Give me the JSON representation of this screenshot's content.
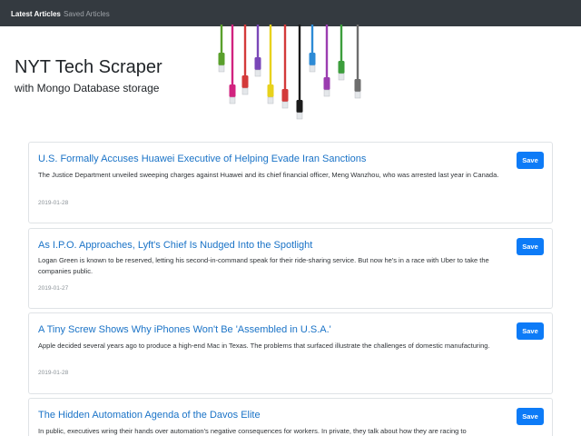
{
  "nav": {
    "items": [
      {
        "label": "Latest Articles",
        "active": true
      },
      {
        "label": "Saved Articles",
        "active": false
      }
    ]
  },
  "hero": {
    "title": "NYT Tech Scraper",
    "subtitle": "with Mongo Database storage",
    "cable_colors": [
      "#5aa02c",
      "#d1237f",
      "#d33a3a",
      "#7a47b8",
      "#e8d21c",
      "#d33a3a",
      "#1b1b1b",
      "#2d8bd6",
      "#9b3db0",
      "#3c9e3c",
      "#6e6e6e"
    ]
  },
  "articles": [
    {
      "title": "U.S. Formally Accuses Huawei Executive of Helping Evade Iran Sanctions",
      "summary": "The Justice Department unveiled sweeping charges against Huawei and its chief financial officer, Meng Wanzhou, who was arrested last year in Canada.",
      "date": "2019-01-28",
      "save_label": "Save"
    },
    {
      "title": "As I.P.O. Approaches, Lyft's Chief Is Nudged Into the Spotlight",
      "summary": "Logan Green is known to be reserved, letting his second-in-command speak for their ride-sharing service. But now he's in a race with Uber to take the companies public.",
      "date": "2019-01-27",
      "save_label": "Save"
    },
    {
      "title": "A Tiny Screw Shows Why iPhones Won't Be 'Assembled in U.S.A.'",
      "summary": "Apple decided several years ago to produce a high-end Mac in Texas. The problems that surfaced illustrate the challenges of domestic manufacturing.",
      "date": "2019-01-28",
      "save_label": "Save"
    },
    {
      "title": "The Hidden Automation Agenda of the Davos Elite",
      "summary": "In public, executives wring their hands over automation's negative consequences for workers. In private, they talk about how they are racing to",
      "date": "",
      "save_label": "Save"
    }
  ]
}
